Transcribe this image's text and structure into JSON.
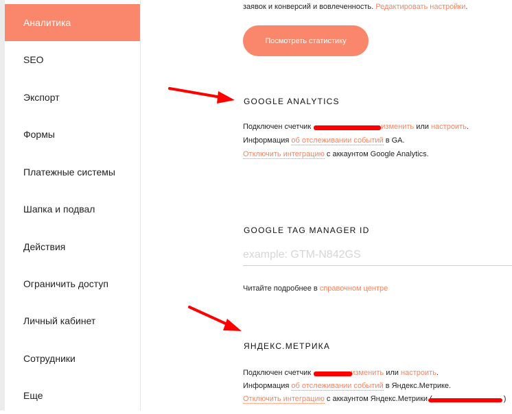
{
  "sidebar": {
    "items": [
      {
        "label": "Аналитика",
        "active": true
      },
      {
        "label": "SEO"
      },
      {
        "label": "Экспорт"
      },
      {
        "label": "Формы"
      },
      {
        "label": "Платежные системы"
      },
      {
        "label": "Шапка и подвал"
      },
      {
        "label": "Действия"
      },
      {
        "label": "Ограничить доступ"
      },
      {
        "label": "Личный кабинет"
      },
      {
        "label": "Сотрудники"
      },
      {
        "label": "Еще"
      }
    ]
  },
  "stats": {
    "intro_text": "заявок и конверсий и вовлеченность.",
    "edit_settings_link": "Редактировать настройки",
    "button_label": "Посмотреть статистику"
  },
  "google_analytics": {
    "title": "GOOGLE ANALYTICS",
    "connected_prefix": "Подключен счетчик",
    "change_link": "изменить",
    "or_text": "или",
    "configure_link": "настроить",
    "info_prefix": "Информация",
    "events_link": "об отслеживании событий",
    "info_suffix": "в GA.",
    "disconnect_link": "Отключить интеграцию",
    "disconnect_suffix": "с аккаунтом Google Analytics."
  },
  "gtm": {
    "title": "GOOGLE TAG MANAGER ID",
    "placeholder": "example: GTM-N842GS",
    "help_prefix": "Читайте подробнее в",
    "help_link": "справочном центре"
  },
  "yandex": {
    "title": "ЯНДЕКС.МЕТРИКА",
    "connected_prefix": "Подключен счетчик",
    "change_link": "изменить",
    "or_text": "или",
    "configure_link": "настроить",
    "info_prefix": "Информация",
    "events_link": "об отслеживании событий",
    "info_suffix": "в Яндекс.Метрике.",
    "disconnect_link": "Отключить интеграцию",
    "disconnect_suffix": "с аккаунтом Яндекс.Метрики ("
  },
  "colors": {
    "accent": "#fa876b",
    "link": "#f4845f",
    "annotation_red": "#ff0000"
  }
}
